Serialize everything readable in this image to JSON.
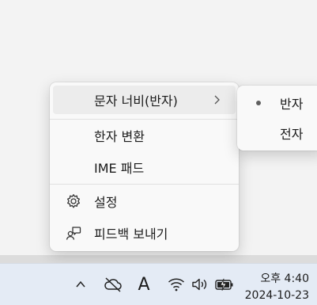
{
  "context_menu": {
    "items": [
      {
        "label": "문자 너비(반자)",
        "has_submenu": true
      },
      {
        "label": "한자 변환"
      },
      {
        "label": "IME 패드"
      },
      {
        "label": "설정",
        "icon": "gear-icon"
      },
      {
        "label": "피드백 보내기",
        "icon": "feedback-icon"
      }
    ]
  },
  "submenu": {
    "items": [
      {
        "label": "반자",
        "selected": true
      },
      {
        "label": "전자",
        "selected": false
      }
    ]
  },
  "taskbar": {
    "ime_indicator": "A",
    "clock": {
      "time": "오후 4:40",
      "date": "2024-10-23"
    },
    "tray_icons": [
      "chevron-up-icon",
      "onedrive-offline-icon",
      "ime-mode-icon",
      "wifi-icon",
      "volume-icon",
      "battery-charging-icon"
    ]
  }
}
